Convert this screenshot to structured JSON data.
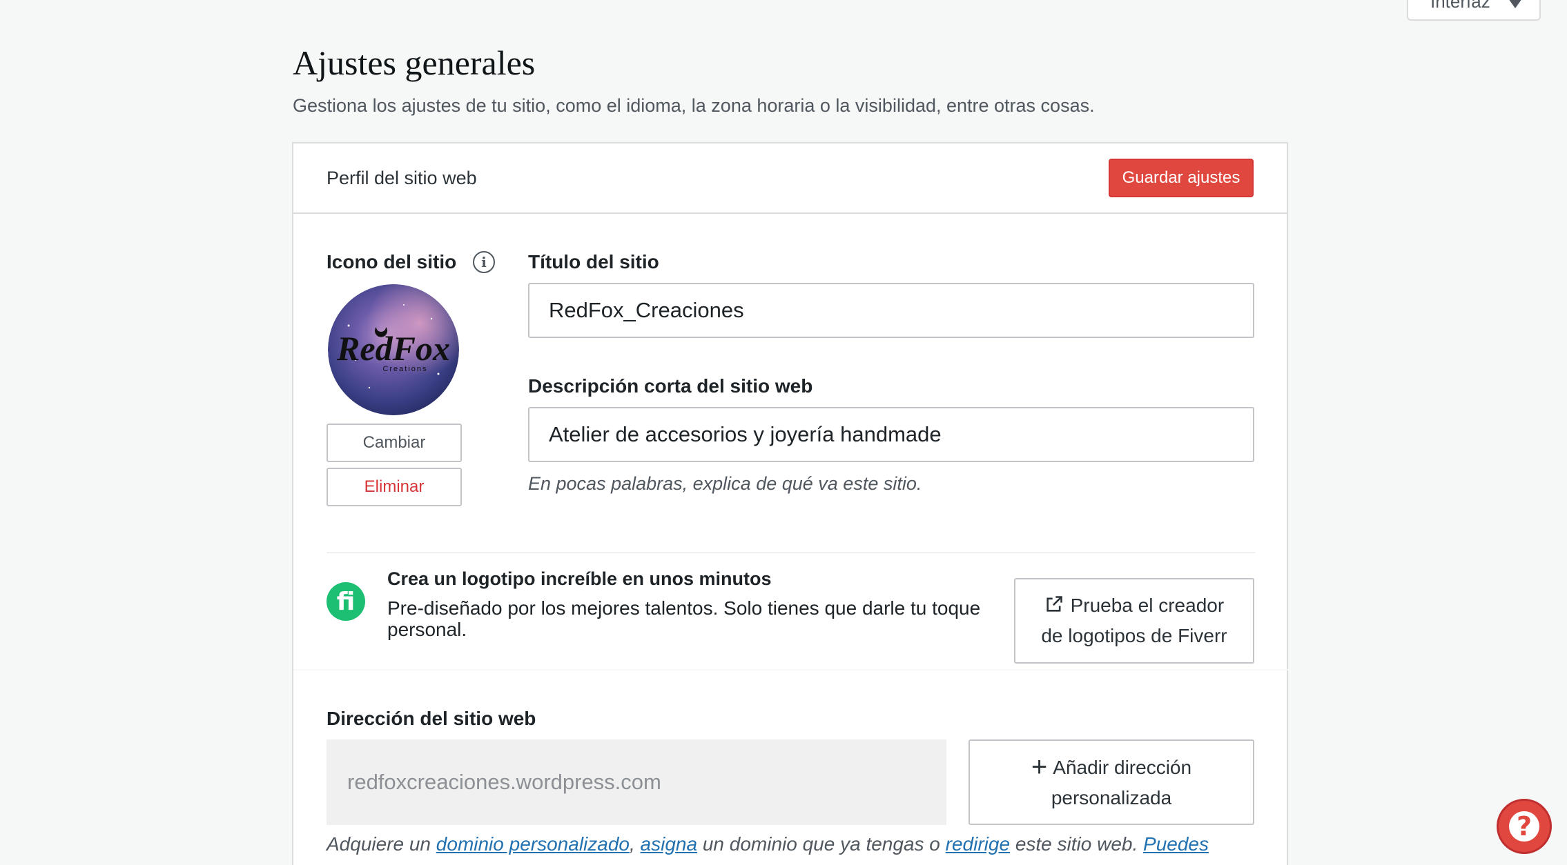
{
  "top_dropdown": {
    "label": "Interfaz"
  },
  "page": {
    "title": "Ajustes generales",
    "subtitle": "Gestiona los ajustes de tu sitio, como el idioma, la zona horaria o la visibilidad, entre otras cosas."
  },
  "card": {
    "header_label": "Perfil del sitio web",
    "save_label": "Guardar ajustes"
  },
  "site_icon": {
    "label": "Icono del sitio",
    "logo_text": "RedFox",
    "logo_subtext": "Creations",
    "change_label": "Cambiar",
    "remove_label": "Eliminar"
  },
  "site_title": {
    "label": "Título del sitio",
    "value": "RedFox_Creaciones"
  },
  "description": {
    "label": "Descripción corta del sitio web",
    "value": "Atelier de accesorios y joyería handmade",
    "helper": "En pocas palabras, explica de qué va este sitio."
  },
  "fiverr": {
    "logo_letter": "fi",
    "title": "Crea un logotipo increíble en unos minutos",
    "description": "Pre-diseñado por los mejores talentos. Solo tienes que darle tu toque personal.",
    "button_line1": "Prueba el creador",
    "button_line2": "de logotipos de Fiverr"
  },
  "address": {
    "label": "Dirección del sitio web",
    "value": "redfoxcreaciones.wordpress.com",
    "add_line1": "Añadir dirección",
    "add_line2": "personalizada"
  },
  "footer": {
    "t1": "Adquiere un",
    "link1": "dominio personalizado",
    "t2": ",",
    "link2": "asigna",
    "t3": "un dominio que ya tengas o",
    "link3": "redirige",
    "t4": "este sitio web.",
    "link4": "Puedes"
  },
  "help": {
    "symbol": "?"
  },
  "colors": {
    "accent_red": "#e0473f",
    "fiverr_green": "#1dbf73",
    "link_blue": "#2271b1"
  }
}
